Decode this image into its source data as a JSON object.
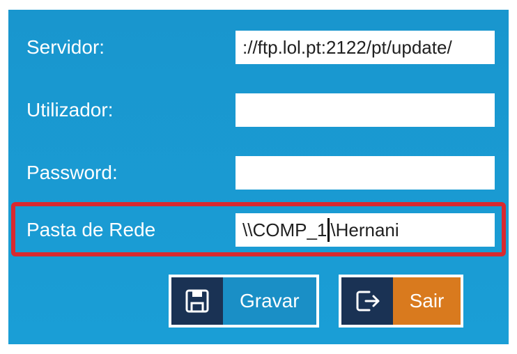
{
  "fields": {
    "servidor": {
      "label": "Servidor:",
      "value": "://ftp.lol.pt:2122/pt/update/"
    },
    "utilizador": {
      "label": "Utilizador:",
      "value": ""
    },
    "password": {
      "label": "Password:",
      "value": ""
    },
    "pasta_de_rede": {
      "label": "Pasta de Rede",
      "value_before_caret": "\\\\COMP_1",
      "value_after_caret": "\\Hernani"
    }
  },
  "buttons": {
    "gravar": "Gravar",
    "sair": "Sair"
  }
}
